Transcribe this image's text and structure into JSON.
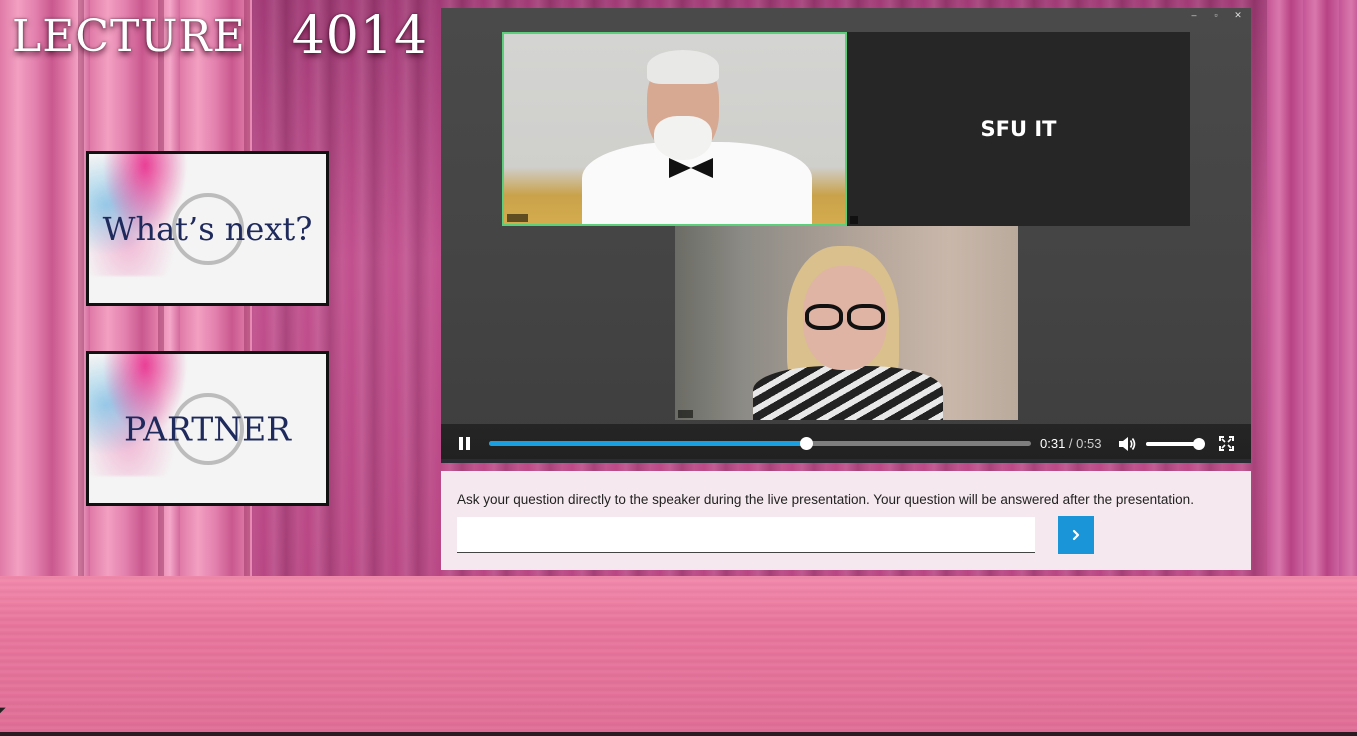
{
  "stage": {
    "title_word": "LECTURE",
    "title_number": "4014"
  },
  "side_cards": {
    "whats_next": "What’s next?",
    "partner": "PARTNER"
  },
  "player": {
    "tiles": {
      "sfu_label": "SFU IT"
    },
    "controls": {
      "current_time": "0:31",
      "separator": " / ",
      "duration": "0:53",
      "progress_fraction": 0.585,
      "volume_fraction": 0.98,
      "accent_color": "#1aa0e0"
    },
    "icons": [
      "pause-icon",
      "volume-icon",
      "fullscreen-icon",
      "minimize-icon",
      "restore-icon",
      "close-icon"
    ]
  },
  "question": {
    "prompt": "Ask your question directly to the speaker during the live presentation. Your question will be answered after the presentation.",
    "input_value": "",
    "submit_icon": "chevron-right-icon",
    "submit_color": "#1a96d8"
  }
}
